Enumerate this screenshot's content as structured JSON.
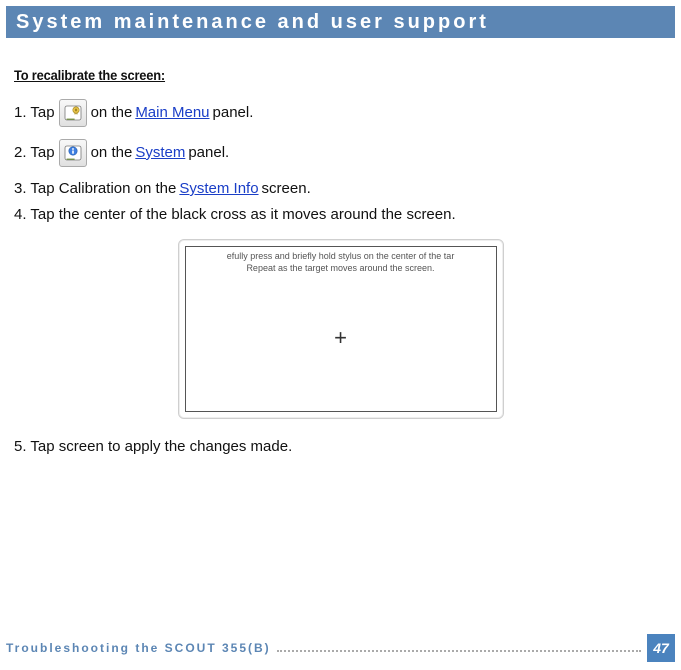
{
  "title": "System maintenance and user support",
  "section_heading": "To recalibrate the screen: ",
  "steps": {
    "s1a": "1. Tap ",
    "s1b": "on the ",
    "s1_link": "Main Menu",
    "s1c": " panel.",
    "s2a": "2. Tap ",
    "s2b": " on the ",
    "s2_link": "System",
    "s2c": " panel.",
    "s3a": "3. Tap Calibration on the ",
    "s3_link": "System Info",
    "s3b": "  screen.",
    "s4": "4. Tap the center of the black cross as it moves around the screen.",
    "s5": "5. Tap screen to apply the changes made."
  },
  "calibration_message_line1": "efully press and briefly hold stylus on the center of the tar",
  "calibration_message_line2": "Repeat as the target moves around the screen.",
  "calibration_cross": "+",
  "footer_text": "Troubleshooting the SCOUT 355(B)",
  "page_number": "47",
  "icons": {
    "main_menu": "system-icon",
    "system": "sys-info-icon"
  }
}
